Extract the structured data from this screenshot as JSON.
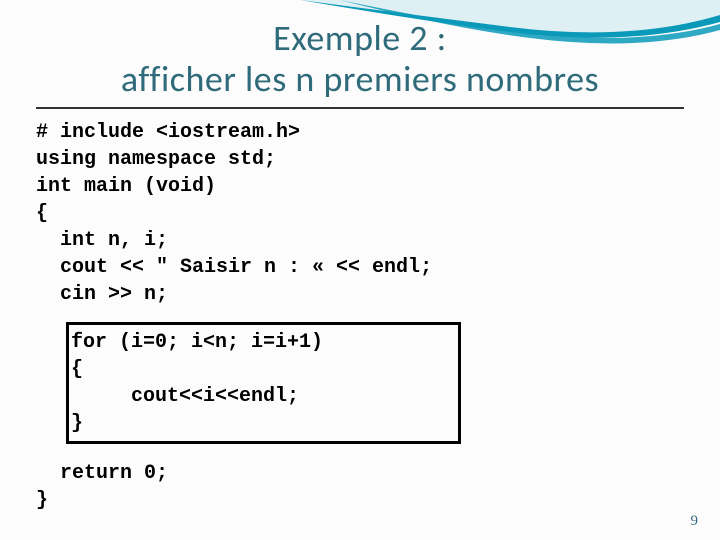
{
  "title_line1": "Exemple 2 :",
  "title_line2": "afficher les n premiers nombres",
  "code": {
    "pre": "# include <iostream.h>\nusing namespace std;\nint main (void)\n{\n  int n, i;\n  cout << \" Saisir n : « << endl;\n  cin >> n;",
    "boxed": "for (i=0; i<n; i=i+1)\n{\n     cout<<i<<endl;\n}",
    "post": "  return 0;\n}"
  },
  "page_number": "9"
}
